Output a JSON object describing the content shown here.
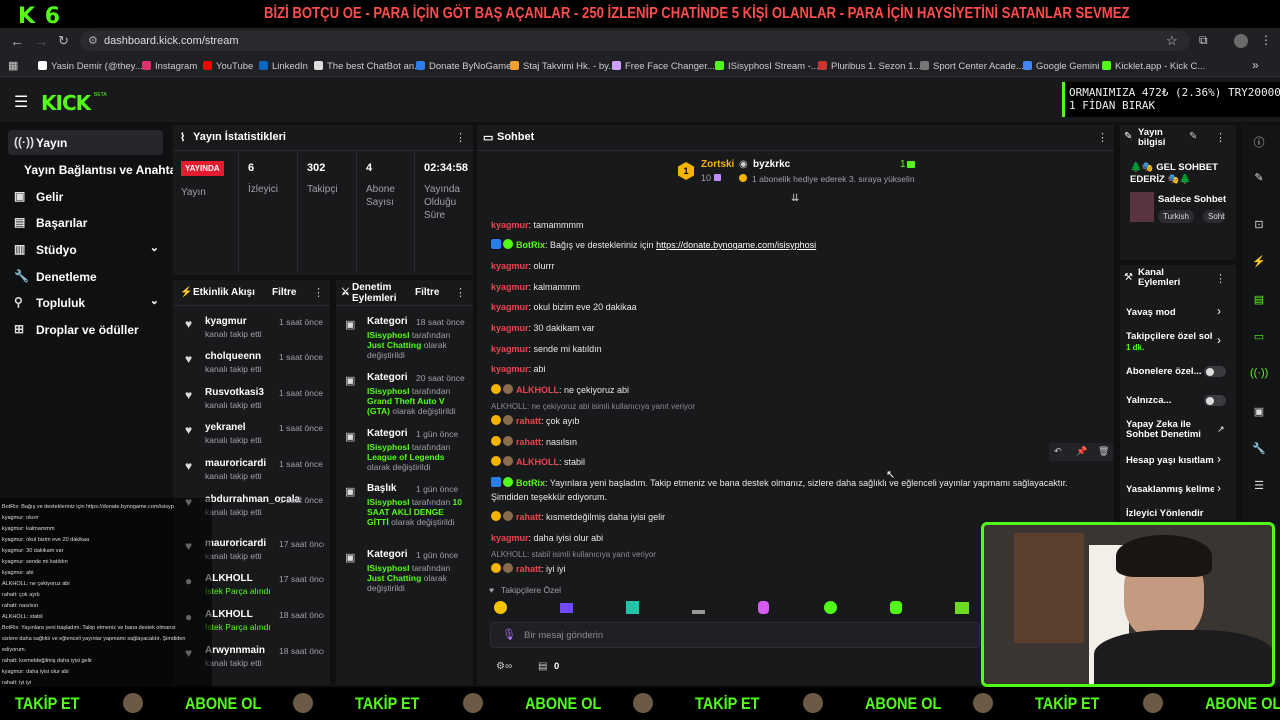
{
  "banner": {
    "logo": "K 6",
    "text": "BİZİ BOTÇU OE - PARA İÇİN GÖT BAŞ AÇANLAR - 250 İZLENİP CHATİNDE 5 KİŞİ OLANLAR - PARA İÇİN HAYSİYETİNİ SATANLAR SEVMEZ"
  },
  "browser": {
    "url": "dashboard.kick.com/stream",
    "bookmarks": [
      "Yasin Demir (@they...",
      "Instagram",
      "YouTube",
      "LinkedIn",
      "The best ChatBot an...",
      "Donate ByNoGame",
      "Staj Takvimi Hk. - by...",
      "Free Face Changer...",
      "ISisyphosI Stream -...",
      "Pluribus 1. Sezon 1...",
      "Sport Center Acade...",
      "Google Gemini",
      "Kicklet.app - Kick C..."
    ]
  },
  "ticker": {
    "line1": "ORMANIMIZA   472₺ (2.36%)   TRY20000",
    "line2": "1 FİDAN BIRAK"
  },
  "logo": "KICK",
  "logo_beta": "BETA",
  "sidebar": [
    {
      "label": "Yayın",
      "icon": "stream-icon"
    },
    {
      "label": "Yayın Bağlantısı ve Anahtarı",
      "icon": ""
    },
    {
      "label": "Gelir",
      "icon": "revenue-icon"
    },
    {
      "label": "Başarılar",
      "icon": "achievements-icon"
    },
    {
      "label": "Stüdyo",
      "icon": "studio-icon"
    },
    {
      "label": "Denetleme",
      "icon": "moderation-icon"
    },
    {
      "label": "Topluluk",
      "icon": "community-icon"
    },
    {
      "label": "Droplar ve ödüller",
      "icon": "drops-icon"
    }
  ],
  "stats": {
    "title": "Yayın İstatistikleri",
    "live_label": "YAYINDA",
    "live_sub": "Yayın",
    "items": [
      {
        "value": "6",
        "label": "İzleyici"
      },
      {
        "value": "302",
        "label": "Takipçi"
      },
      {
        "value": "4",
        "label": "Abone Sayısı"
      },
      {
        "value": "02:34:58",
        "label": "Yayında Olduğu Süre"
      }
    ]
  },
  "activity": {
    "title": "Etkinlik Akışı",
    "filter": "Filtre",
    "items": [
      {
        "name": "kyagmur",
        "sub": "kanalı takip etti",
        "time": "1 saat önce"
      },
      {
        "name": "cholqueenn",
        "sub": "kanalı takip etti",
        "time": "1 saat önce"
      },
      {
        "name": "Rusvotkasi3",
        "sub": "kanalı takip etti",
        "time": "1 saat önce"
      },
      {
        "name": "yekranel",
        "sub": "kanalı takip etti",
        "time": "1 saat önce"
      },
      {
        "name": "mauroricardi",
        "sub": "kanalı takip etti",
        "time": "1 saat önce"
      },
      {
        "name": "abdurrahman_ocalan",
        "sub": "kanalı takip etti",
        "time": "1 saat önce"
      },
      {
        "name": "mauroricardi",
        "sub": "kanalı takip etti",
        "time": "17 saat önce"
      },
      {
        "name": "ALKHOLL",
        "sub": "İstek Parça alındı",
        "time": "17 saat önce"
      },
      {
        "name": "ALKHOLL",
        "sub": "İstek Parça alındı",
        "time": "18 saat önce"
      },
      {
        "name": "Arwynnmain",
        "sub": "kanalı takip etti",
        "time": "18 saat önce"
      }
    ]
  },
  "modlog": {
    "title": "Denetim Eylemleri",
    "filter": "Filtre",
    "items": [
      {
        "title": "Kategori",
        "time": "18 saat önce",
        "actor": "ISisyphosI",
        "by": "tarafından",
        "value": "Just Chatting",
        "tail": "olarak değiştirildi"
      },
      {
        "title": "Kategori",
        "time": "20 saat önce",
        "actor": "ISisyphosI",
        "by": "tarafından",
        "value": "Grand Theft Auto V (GTA)",
        "tail": "olarak değiştirildi"
      },
      {
        "title": "Kategori",
        "time": "1 gün önce",
        "actor": "ISisyphosI",
        "by": "tarafından",
        "value": "League of Legends",
        "tail": "olarak değiştirildi"
      },
      {
        "title": "Başlık",
        "time": "1 gün önce",
        "actor": "ISisyphosI",
        "by": "tarafından",
        "value": "10 SAAT AKLİ DENGE GİTTİ",
        "tail": "olarak değiştirildi"
      },
      {
        "title": "Kategori",
        "time": "1 gün önce",
        "actor": "ISisyphosI",
        "by": "tarafından",
        "value": "Just Chatting",
        "tail": "olarak değiştirildi"
      }
    ]
  },
  "chat": {
    "title": "Sohbet",
    "top_user": "Zortski",
    "top_count": "10",
    "gifter": "byzkrkc",
    "gift_note": "1 abonelik hediye ederek 3. sıraya yükselin",
    "gift_count": "1",
    "messages": [
      {
        "user": "kyagmur",
        "text": "tamammmm",
        "color": "red"
      },
      {
        "user": "BotRix",
        "text": "Bağış ve destekleriniz için ",
        "link": "https://donate.bynogame.com/isisyphosi",
        "color": "green"
      },
      {
        "user": "kyagmur",
        "text": "olurrr",
        "color": "red"
      },
      {
        "user": "kyagmur",
        "text": "kalmammm",
        "color": "red"
      },
      {
        "user": "kyagmur",
        "text": "okul bizim eve 20 dakikaa",
        "color": "red"
      },
      {
        "user": "kyagmur",
        "text": "30 dakikam var",
        "color": "red"
      },
      {
        "user": "kyagmur",
        "text": "sende mi katıldın",
        "color": "red"
      },
      {
        "user": "kyagmur",
        "text": "abi",
        "color": "red"
      },
      {
        "user": "ALKHOLL",
        "text": "ne çekiyoruz abi",
        "color": "red"
      },
      {
        "reply": "ALKHOLL: ne çekiyoruz abi isimli kullanıcıya yanıt veriyor"
      },
      {
        "user": "rahatt",
        "text": "çok ayıb",
        "color": "red"
      },
      {
        "user": "rahatt",
        "text": "nasılsın",
        "color": "red"
      },
      {
        "user": "ALKHOLL",
        "text": "stabil",
        "color": "red"
      },
      {
        "user": "BotRix",
        "text": "Yayınlara yeni başladım. Takip etmeniz ve bana destek olmanız, sizlere daha sağlıklı ve eğlenceli yayınlar yapmamı sağlayacaktır.",
        "text2": "Şimdiden teşekkür ediyorum.",
        "color": "green"
      },
      {
        "user": "rahatt",
        "text": "kısmetdeğilmiş daha iyisi gelir",
        "color": "red"
      },
      {
        "user": "kyagmur",
        "text": "daha iyisi olur abi",
        "color": "red"
      },
      {
        "reply": "ALKHOLL: stabil isimli kullanıcıya yanıt veriyor"
      },
      {
        "user": "rahatt",
        "text": "iyi iyi",
        "color": "red"
      }
    ],
    "followers_only": "Takipçilere Özel",
    "placeholder": "Bir mesaj gönderin",
    "footer_count": "0"
  },
  "right_panel": {
    "info_title": "Yayın bilgisi",
    "stream_title": "GEL SOHBET EDERİZ",
    "category": "Sadece Sohbet",
    "tags": [
      "Turkish",
      "Sohb"
    ],
    "actions_title": "Kanal Eylemleri",
    "actions": [
      {
        "label": "Yavaş mod"
      },
      {
        "label": "Takipçilere özel soh",
        "sub": "1 dk."
      },
      {
        "label": "Abonelere özel..."
      },
      {
        "label": "Yalnızca..."
      },
      {
        "label": "Yapay Zeka ile Sohbet Denetimi"
      },
      {
        "label": "Hesap yaşı kısıtlam"
      },
      {
        "label": "Yasaklanmış kelime"
      },
      {
        "label": "İzleyici Yönlendir"
      }
    ]
  },
  "overlay_chat": [
    "BotRix: Bağış ve destekleriniz için https://donate.bynogame.com/isisyp",
    "kyagmur: olurrr",
    "kyagmur: kalmammm",
    "kyagmur: okul bizim eve 20 dakikaa",
    "kyagmur: 30 dakikam var",
    "kyagmur: sende mi katıldın",
    "kyagmur: abi",
    "ALKHOLL: ne çekiyoruz abi",
    "rahatt: çok ayıb",
    "rahatt: nasılsın",
    "ALKHOLL: stabil",
    "BotRix: Yayınlara yeni başladım. Takip etmeniz ve bana destek olmanız",
    "sizlere daha sağlıklı ve eğlenceli yayınlar yapmamı sağlayacaktır. Şimdiden",
    "ediyorum.",
    "rahatt: kısmetdeğilmiş daha iyisi gelir",
    "kyagmur: daha iyisi olur abi",
    "rahatt: iyi iyi"
  ],
  "bottom_bar": [
    "TAKİP ET",
    "ABONE OL"
  ],
  "colors": {
    "accent": "#53fc18",
    "banner_text": "#ff4d4d",
    "username": "#e5484d"
  }
}
